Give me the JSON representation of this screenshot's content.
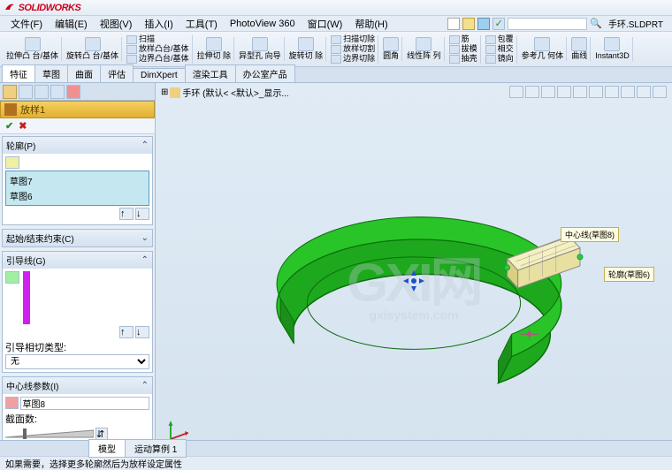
{
  "app": {
    "name": "SOLIDWORKS"
  },
  "menu": {
    "file": "文件(F)",
    "edit": "编辑(E)",
    "view": "视图(V)",
    "insert": "插入(I)",
    "tools": "工具(T)",
    "pv360": "PhotoView 360",
    "window": "窗口(W)",
    "help": "帮助(H)"
  },
  "header": {
    "filename": "手环.SLDPRT"
  },
  "ribbon": {
    "g1": "拉伸凸\n台/基体",
    "g2": "旋转凸\n台/基体",
    "g3a": "扫描",
    "g3b": "放样凸台/基体",
    "g3c": "边界凸台/基体",
    "g4": "拉伸切\n除",
    "g5": "异型孔\n向导",
    "g6": "旋转切\n除",
    "g7a": "扫描切除",
    "g7b": "放样切割",
    "g7c": "边界切除",
    "g8": "圆角",
    "g9": "线性阵\n列",
    "g10a": "筋",
    "g10b": "拔模",
    "g10c": "抽壳",
    "g11a": "包覆",
    "g11b": "相交",
    "g11c": "镜向",
    "g12": "参考几\n何体",
    "g13": "曲线",
    "g14": "Instant3D"
  },
  "tabs": {
    "t1": "特征",
    "t2": "草图",
    "t3": "曲面",
    "t4": "评估",
    "t5": "DimXpert",
    "t6": "渲染工具",
    "t7": "办公室产品"
  },
  "pm": {
    "title": "放样1",
    "section_profile": "轮廓(P)",
    "profile_items": [
      "草图7",
      "草图6"
    ],
    "section_constraint": "起始/结束约束(C)",
    "section_guide": "引导线(G)",
    "guide_tangent_label": "引导相切类型:",
    "guide_tangent_value": "无",
    "section_centerline": "中心线参数(I)",
    "centerline_value": "草图8",
    "section_facets": "截面数:"
  },
  "viewport": {
    "breadcrumb": "手环  (默认< <默认>_显示...",
    "callout1": "中心线(草图8)",
    "callout2": "轮廓(草图6)",
    "watermark": "GXI网",
    "watermark_sub": "gxisystem.com"
  },
  "bottomtabs": {
    "t1": "模型",
    "t2": "运动算例 1"
  },
  "status": {
    "msg": "如果需要，选择更多轮廓然后为放样设定属性"
  }
}
